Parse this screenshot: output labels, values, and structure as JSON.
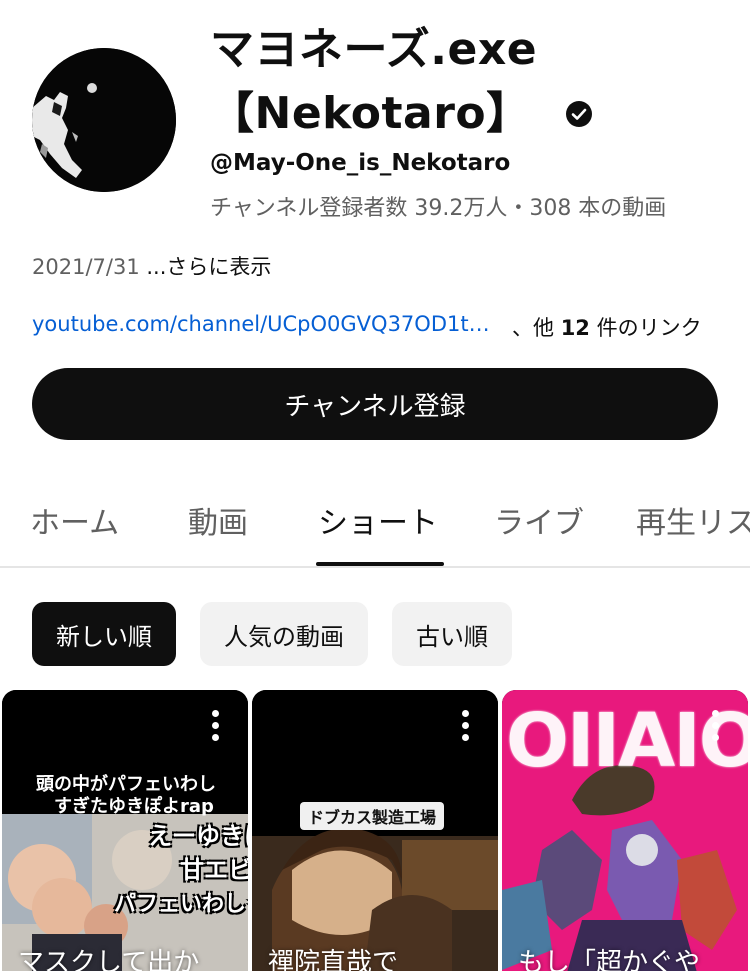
{
  "channel": {
    "title_line1": "マヨネーズ.exe",
    "title_line2": "【Nekotaro】",
    "handle": "@May-One_is_Nekotaro",
    "meta": "チャンネル登録者数 39.2万人・308 本の動画",
    "description_date": "2021/7/31",
    "description_more": "...さらに表示",
    "link_url": "youtube.com/channel/UCpO0GVQ37OD1t…",
    "link_prefix": "、他",
    "link_count": "12",
    "link_suffix": "件のリンク",
    "subscribe_label": "チャンネル登録"
  },
  "tabs": [
    {
      "label": "ホーム",
      "active": false
    },
    {
      "label": "動画",
      "active": false
    },
    {
      "label": "ショート",
      "active": true
    },
    {
      "label": "ライブ",
      "active": false
    },
    {
      "label": "再生リスト",
      "active": false
    }
  ],
  "sort_chips": [
    {
      "label": "新しい順",
      "active": true
    },
    {
      "label": "人気の動画",
      "active": false
    },
    {
      "label": "古い順",
      "active": false
    }
  ],
  "shorts": [
    {
      "caption": "マスクして出か",
      "overlay_top": "頭の中がパフェいわし",
      "overlay_top2": "すぎたゆきぽよrap",
      "overlay_side1": "えーゆきは",
      "overlay_side2": "甘エビ",
      "overlay_side3": "パフェいわし★"
    },
    {
      "caption": "禪院直哉で",
      "overlay_label": "ドブカス製造工場"
    },
    {
      "caption": "もし「超かぐや",
      "overlay_big": "OIIAIO"
    }
  ],
  "colors": {
    "link": "#065fd4",
    "secondary_text": "#606060",
    "primary": "#0f0f0f",
    "chip_bg": "#f2f2f2",
    "pink_bg": "#e8197d"
  },
  "icons": {
    "verified": "verified-check-icon",
    "more": "more-vert-icon"
  }
}
